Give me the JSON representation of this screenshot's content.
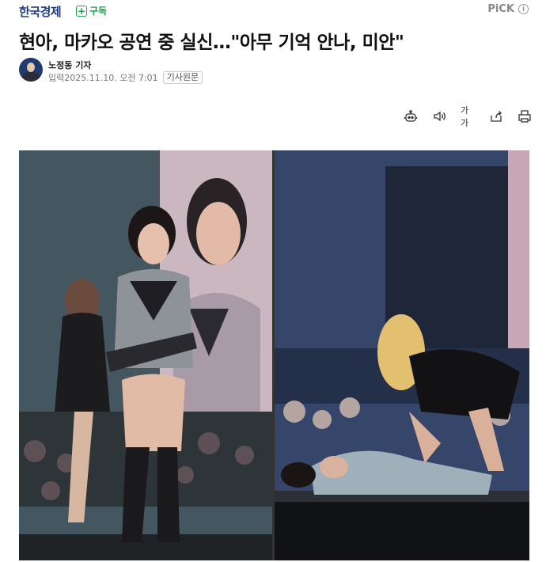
{
  "header": {
    "brand": "한국경제",
    "subscribe_label": "구독",
    "pick_label": "PiCK",
    "pick_info_glyph": "i"
  },
  "article": {
    "headline": "현아, 마카오 공연 중 실신…\"아무 기억 안나, 미안\"",
    "reporter": "노정동 기자",
    "date": "입력2025.11.10. 오전 7:01",
    "original_button": "기사원문"
  },
  "toolbar": {
    "items": [
      {
        "icon": "robot-summary-icon"
      },
      {
        "icon": "speaker-icon"
      },
      {
        "icon": "font-size-icon",
        "label": "가가"
      },
      {
        "icon": "share-icon"
      },
      {
        "icon": "print-icon"
      }
    ]
  },
  "colors": {
    "brand": "#1d3a8a",
    "subscribe": "#1aa34a",
    "muted": "#777777"
  },
  "photo": {
    "panels": [
      "stage-performance-left",
      "stage-fall-right"
    ]
  }
}
